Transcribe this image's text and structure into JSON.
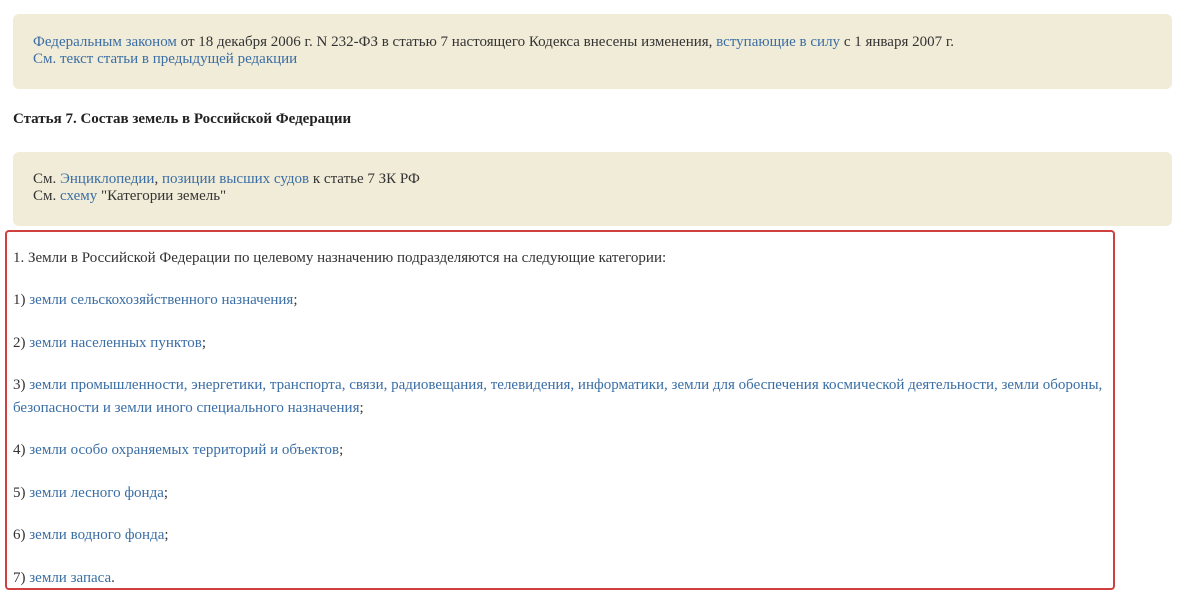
{
  "note1": {
    "link1": "Федеральным законом",
    "text1": " от 18 декабря 2006 г. N 232-ФЗ в статью 7 настоящего Кодекса внесены изменения, ",
    "link2": "вступающие в силу",
    "text2": " с 1 января 2007 г.",
    "link3": "См. текст статьи в предыдущей редакции"
  },
  "article_title": "Статья 7. Состав земель в Российской Федерации",
  "note2": {
    "prefix1": "См. ",
    "link1": "Энциклопедии",
    "sep": ", ",
    "link2": "позиции высших судов",
    "text1": " к статье 7 ЗК РФ",
    "prefix2": "См. ",
    "link3": "схему",
    "text2": " \"Категории земель\""
  },
  "content": {
    "intro": "1. Земли в Российской Федерации по целевому назначению подразделяются на следующие категории:",
    "items": [
      {
        "num": "1) ",
        "link": "земли сельскохозяйственного назначения",
        "tail": ";"
      },
      {
        "num": "2) ",
        "link": "земли населенных пунктов",
        "tail": ";"
      },
      {
        "num": "3) ",
        "link": "земли промышленности, энергетики, транспорта, связи, радиовещания, телевидения, информатики, земли для обеспечения космической деятельности, земли обороны, безопасности и земли иного специального назначения",
        "tail": ";"
      },
      {
        "num": "4) ",
        "link": "земли особо охраняемых территорий и объектов",
        "tail": ";"
      },
      {
        "num": "5) ",
        "link": "земли лесного фонда",
        "tail": ";"
      },
      {
        "num": "6) ",
        "link": "земли водного фонда",
        "tail": ";"
      },
      {
        "num": "7) ",
        "link": "земли запаса",
        "tail": "."
      }
    ]
  },
  "colors": {
    "link": "#3a6ea5",
    "note_bg": "#f1ecd8",
    "highlight": "#d04040"
  }
}
